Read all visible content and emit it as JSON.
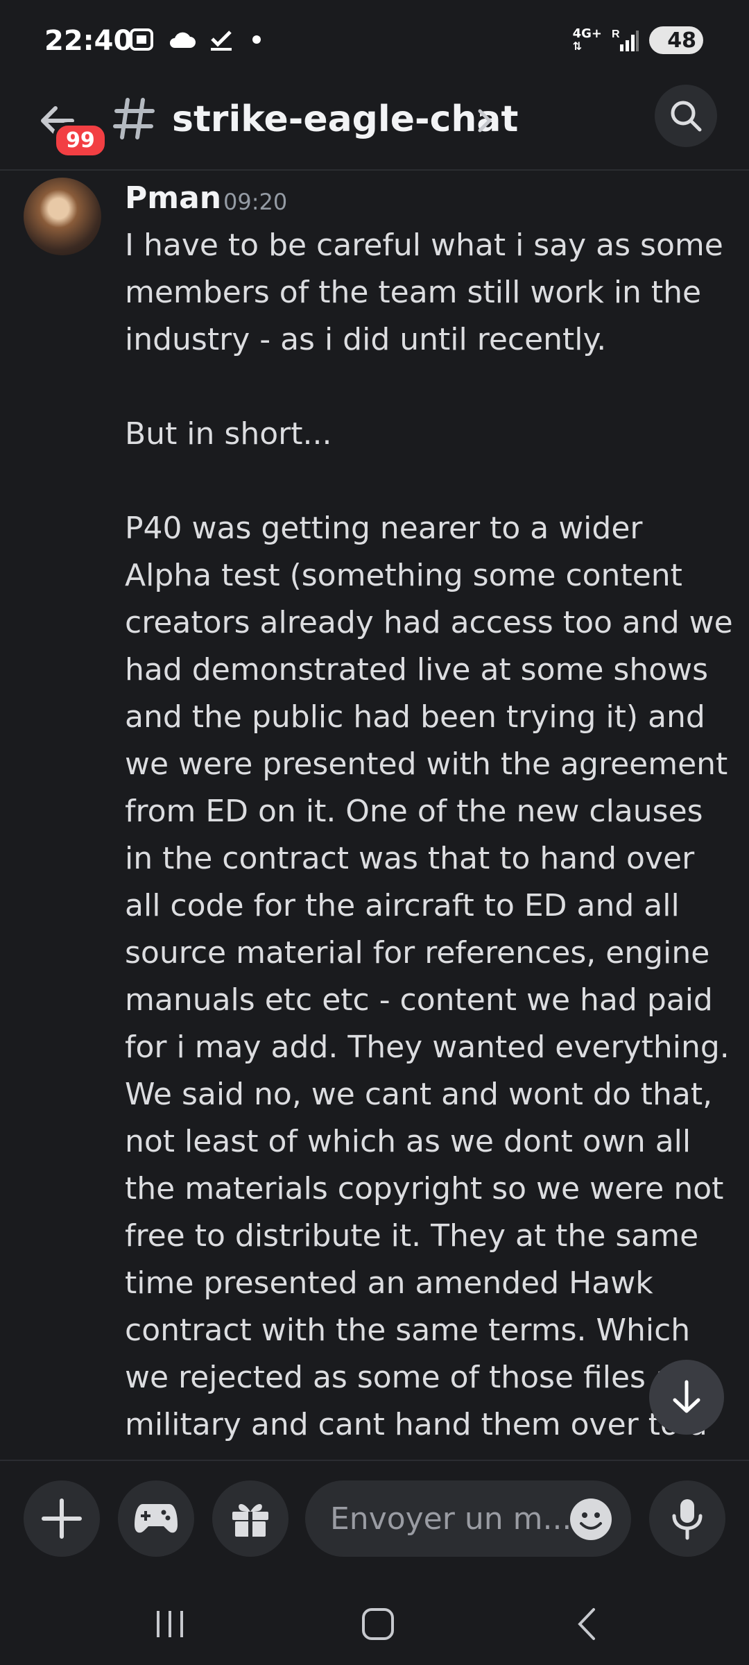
{
  "status_bar": {
    "time": "22:40",
    "network": "4G+",
    "roaming": "R",
    "battery": "48"
  },
  "header": {
    "back_badge": "99",
    "channel_name": "strike-eagle-chat"
  },
  "message": {
    "author": "Pman",
    "time": "09:20",
    "paragraphs": [
      "I have to be careful what i say as some members of the team still work in the industry - as i did until recently.",
      "But in short...",
      "P40 was getting nearer to a wider Alpha test (something some content creators already had access too and we had demonstrated live at some shows and the public had been trying it) and we were presented with the agreement from ED on it. One of the new clauses in the contract was that to hand over all code for the aircraft to ED and all source material for references, engine manuals etc etc - content we had paid for i may add. They wanted everything. We said no, we cant and wont do that, not least of which as we dont own all the materials copyright so we were not free to distribute it. They at the same time presented an amended Hawk contract with the same terms. Which we rejected as some of those files are military and cant hand them over to a russian"
    ]
  },
  "composer": {
    "placeholder": "Envoyer un m..."
  },
  "icons": {
    "back": "arrow-left-icon",
    "channel": "hash-icon",
    "search": "search-icon",
    "add": "plus-icon",
    "games": "gamepad-icon",
    "gift": "gift-icon",
    "emoji": "emoji-icon",
    "mic": "microphone-icon",
    "scroll": "arrow-down-icon"
  },
  "colors": {
    "background": "#1a1b1e",
    "badge": "#f23f43",
    "surface": "#2b2d31"
  }
}
